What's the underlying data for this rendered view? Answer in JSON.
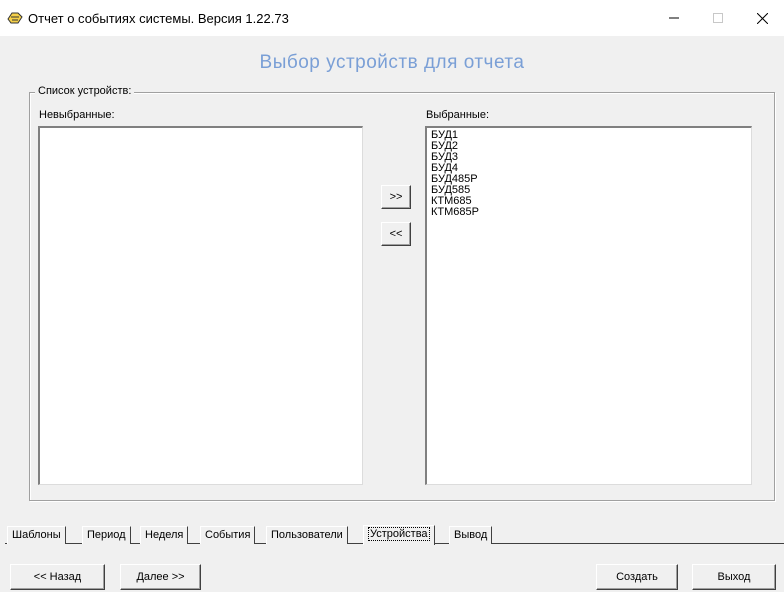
{
  "window": {
    "title": "Отчет о событиях системы.  Версия 1.22.73",
    "app_icon": "app-logo-icon",
    "controls": {
      "minimize": "—",
      "maximize": "□",
      "close": "✕"
    }
  },
  "page": {
    "heading": "Выбор устройств для отчета"
  },
  "device_list": {
    "group_label": "Список устройств:",
    "unselected_label": "Невыбранные:",
    "selected_label": "Выбранные:",
    "unselected_items": [],
    "selected_items": [
      "БУД1",
      "БУД2",
      "БУД3",
      "БУД4",
      "БУД485Р",
      "БУД585",
      "КТМ685",
      "КТМ685Р"
    ],
    "add_button": ">>",
    "remove_button": "<<"
  },
  "tabs": [
    {
      "label": "Шаблоны",
      "active": false
    },
    {
      "label": "Период",
      "active": false
    },
    {
      "label": "Неделя",
      "active": false
    },
    {
      "label": "События",
      "active": false
    },
    {
      "label": "Пользователи",
      "active": false
    },
    {
      "label": "Устройства",
      "active": true
    },
    {
      "label": "Вывод",
      "active": false
    }
  ],
  "footer": {
    "back": "<< Назад",
    "next": "Далее >>",
    "create": "Создать",
    "exit": "Выход"
  }
}
